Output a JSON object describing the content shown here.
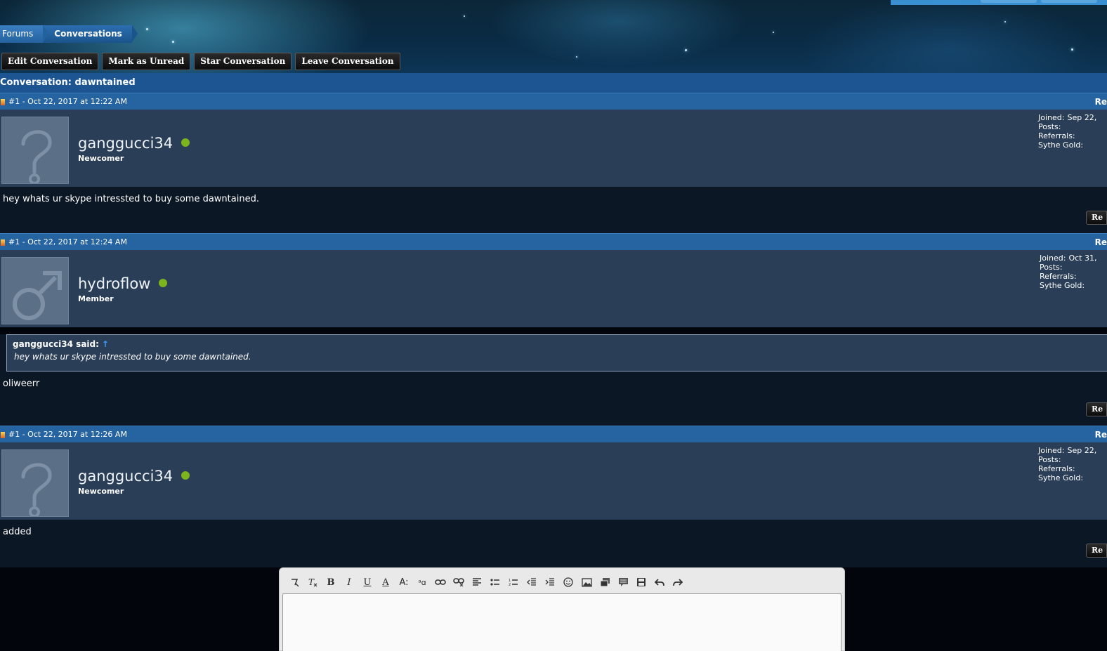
{
  "breadcrumb": {
    "items": [
      "Forums",
      "Conversations"
    ]
  },
  "actions": {
    "edit": "Edit Conversation",
    "unread": "Mark as Unread",
    "star": "Star Conversation",
    "leave": "Leave Conversation"
  },
  "conversation": {
    "title": "Conversation: dawntained"
  },
  "stats_labels": {
    "joined": "Joined:",
    "posts": "Posts:",
    "referrals": "Referrals:",
    "gold": "Sythe Gold:"
  },
  "messages": [
    {
      "header": "#1 - Oct 22, 2017 at 12:22 AM",
      "reply_link": "Re",
      "username": "ganggucci34",
      "user_title": "Newcomer",
      "avatar_icon": "question-mark-avatar-icon",
      "joined": "Sep 22,",
      "text": "hey whats ur skype intressted to buy some dawntained.",
      "reply_button": "Re"
    },
    {
      "header": "#1 - Oct 22, 2017 at 12:24 AM",
      "reply_link": "Re",
      "username": "hydroflow",
      "user_title": "Member",
      "avatar_icon": "male-symbol-avatar-icon",
      "joined": "Oct 31,",
      "quote": {
        "author": "ganggucci34 said:",
        "arrow": "↑",
        "text": "hey whats ur skype intressted to buy some dawntained."
      },
      "text": "oliweerr",
      "reply_button": "Re"
    },
    {
      "header": "#1 - Oct 22, 2017 at 12:26 AM",
      "reply_link": "Re",
      "username": "ganggucci34",
      "user_title": "Newcomer",
      "avatar_icon": "question-mark-avatar-icon",
      "joined": "Sep 22,",
      "text": "added",
      "reply_button": "Re"
    }
  ],
  "editor": {
    "toolbar": [
      "remove-format-icon",
      "clear-formatting-icon",
      "bold-icon",
      "italic-icon",
      "underline-icon",
      "text-color-icon",
      "font-size-icon",
      "font-family-icon",
      "link-icon",
      "unlink-icon",
      "align-icon",
      "bullet-list-icon",
      "numbered-list-icon",
      "outdent-icon",
      "indent-icon",
      "smiley-icon",
      "image-icon",
      "media-icon",
      "quote-icon",
      "save-draft-icon",
      "undo-icon",
      "redo-icon"
    ],
    "glyphs": {
      "bold": "B",
      "italic": "I",
      "underline": "U",
      "text_color": "A",
      "font_size": "A:",
      "font_family": "ᵃɑ"
    }
  },
  "colors": {
    "title_bar": "#1d5593",
    "message_header": "#2563a1",
    "user_panel": "#2b3e57",
    "message_body": "#0c1726",
    "online": "#7bb51e"
  }
}
